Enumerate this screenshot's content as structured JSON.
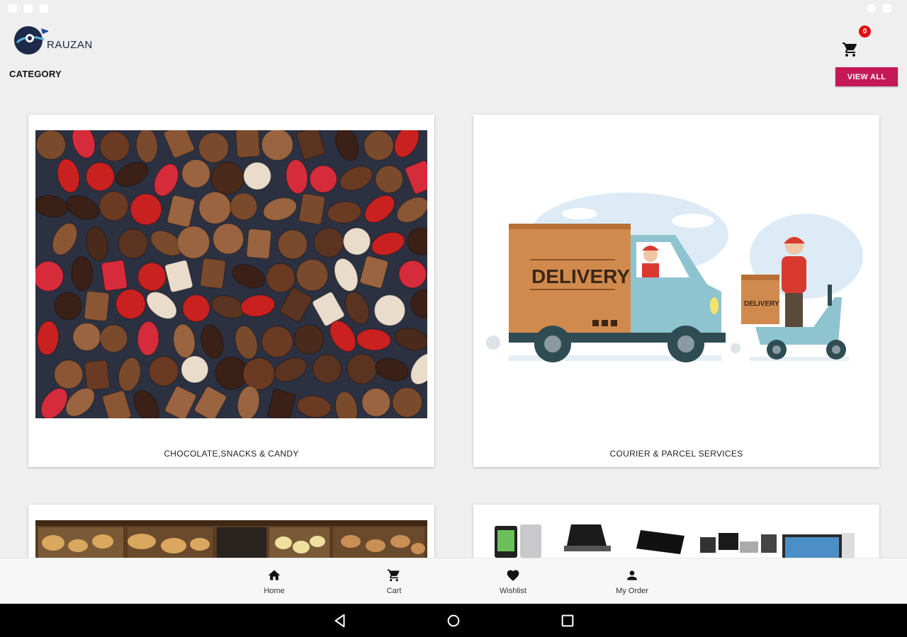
{
  "app": {
    "brand_name": "RAUZAN"
  },
  "header": {
    "category_heading": "CATEGORY",
    "cart_count": "0",
    "view_all_label": "VIEW ALL"
  },
  "categories": [
    {
      "label": "CHOCOLATE,SNACKS & CANDY",
      "image": "chocolates-photo"
    },
    {
      "label": "COURIER & PARCEL SERVICES",
      "image": "delivery-illustration",
      "illustration_text": "DELIVERY",
      "box_text": "DELIVERY"
    },
    {
      "label": "",
      "image": "nuts-photo"
    },
    {
      "label": "",
      "image": "electronics-photo"
    }
  ],
  "bottom_nav": [
    {
      "label": "Home",
      "icon": "home-icon"
    },
    {
      "label": "Cart",
      "icon": "cart-icon"
    },
    {
      "label": "Wishlist",
      "icon": "heart-icon"
    },
    {
      "label": "My Order",
      "icon": "person-icon"
    }
  ],
  "colors": {
    "accent": "#c31a55",
    "badge": "#e01010"
  }
}
